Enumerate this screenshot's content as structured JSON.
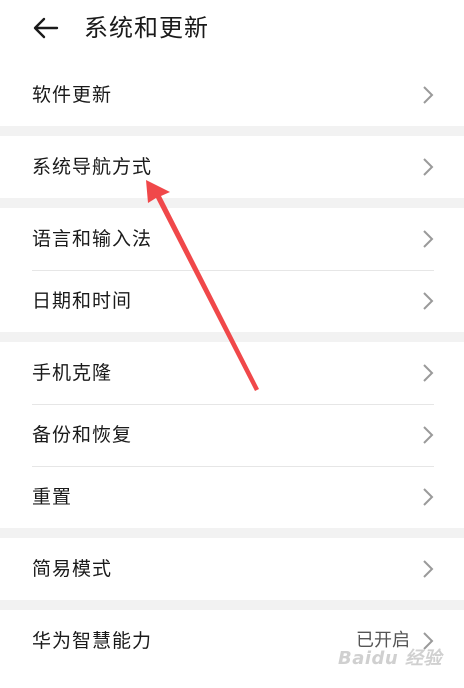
{
  "header": {
    "title": "系统和更新"
  },
  "groups": [
    {
      "items": [
        {
          "label": "软件更新"
        }
      ]
    },
    {
      "items": [
        {
          "label": "系统导航方式"
        }
      ]
    },
    {
      "items": [
        {
          "label": "语言和输入法"
        },
        {
          "label": "日期和时间"
        }
      ]
    },
    {
      "items": [
        {
          "label": "手机克隆"
        },
        {
          "label": "备份和恢复"
        },
        {
          "label": "重置"
        }
      ]
    },
    {
      "items": [
        {
          "label": "简易模式"
        }
      ]
    },
    {
      "items": [
        {
          "label": "华为智慧能力",
          "value": "已开启"
        }
      ]
    }
  ],
  "icons": {
    "back": "back-arrow-icon",
    "chevron": "chevron-right-icon"
  },
  "colors": {
    "arrow_annotation": "#f0484a",
    "separator": "#e6e6e6",
    "gap": "#f2f2f2"
  },
  "watermark": "Baidu 经验"
}
